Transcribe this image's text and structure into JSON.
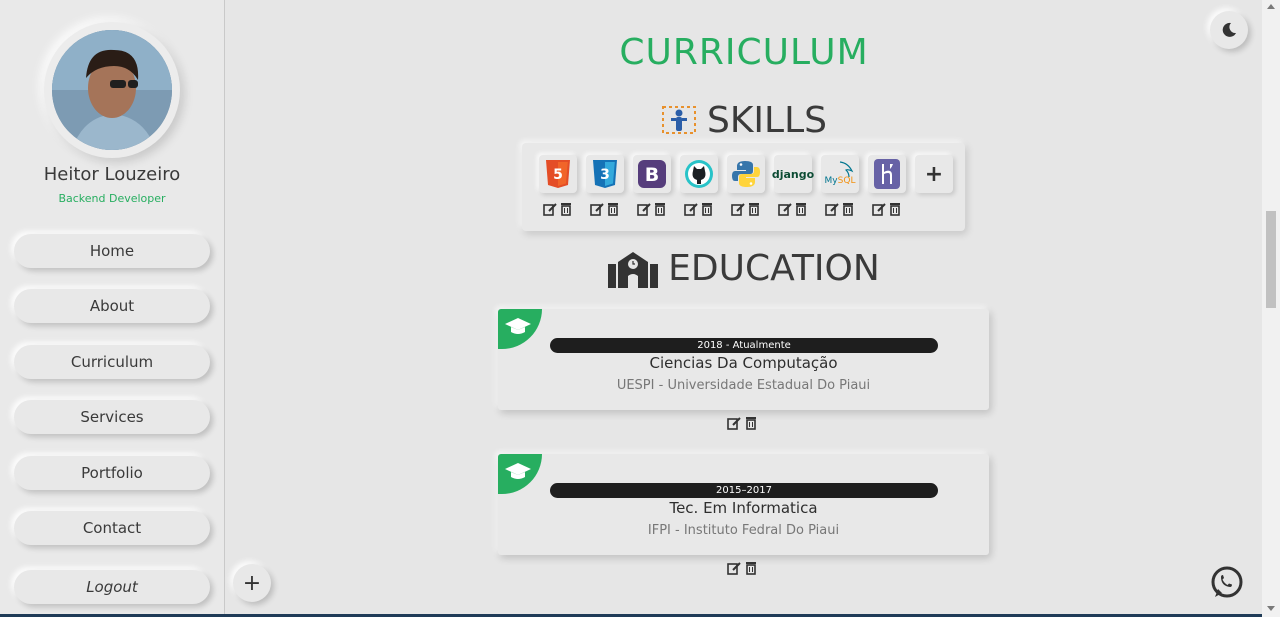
{
  "profile": {
    "name": "Heitor Louzeiro",
    "role": "Backend Developer"
  },
  "nav": {
    "items": [
      "Home",
      "About",
      "Curriculum",
      "Services",
      "Portfolio",
      "Contact"
    ],
    "logout": "Logout"
  },
  "main": {
    "title": "CURRICULUM",
    "skills_heading": "SKILLS",
    "education_heading": "EDUCATION",
    "skills": [
      {
        "icon": "html5-icon"
      },
      {
        "icon": "css3-icon"
      },
      {
        "icon": "bootstrap-icon"
      },
      {
        "icon": "github-icon"
      },
      {
        "icon": "python-icon",
        "label": ""
      },
      {
        "icon": "django-icon",
        "label": "django"
      },
      {
        "icon": "mysql-icon",
        "label": "MySQL"
      },
      {
        "icon": "heroku-icon"
      }
    ],
    "add_skill": "+",
    "education": [
      {
        "period": "2018 - Atualmente",
        "course": "Ciencias Da Computação",
        "institution": "UESPI - Universidade Estadual Do Piaui"
      },
      {
        "period": "2015–2017",
        "course": "Tec. Em Informatica",
        "institution": "IFPI - Instituto Fedral Do Piaui"
      }
    ]
  },
  "floating": {
    "add": "+"
  },
  "colors": {
    "accent": "#27ae60",
    "background": "#e6e6e6",
    "text": "#3a3a3a"
  }
}
